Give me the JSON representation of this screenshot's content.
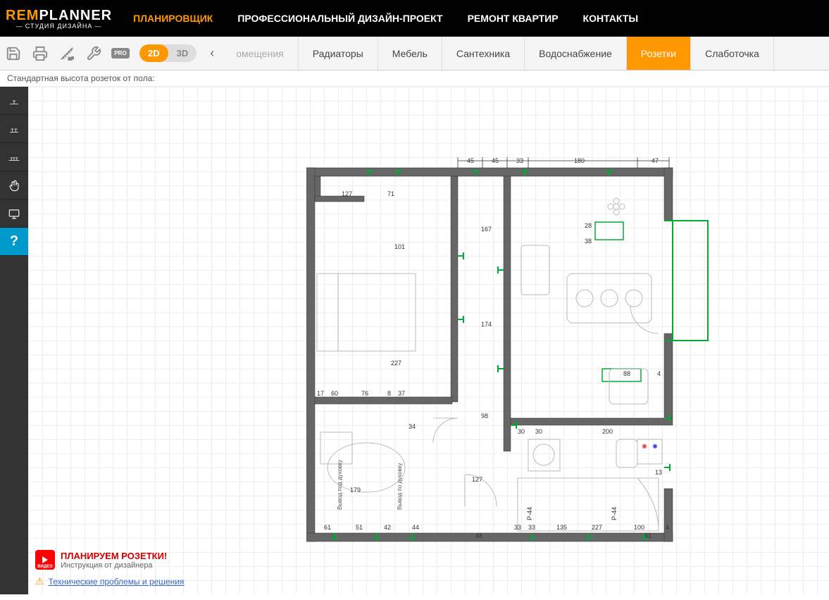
{
  "brand": {
    "rem": "REM",
    "planner": "PLANNER",
    "sub": "СТУДИЯ ДИЗАЙНА"
  },
  "nav": {
    "items": [
      "ПЛАНИРОВЩИК",
      "ПРОФЕССИОНАЛЬНЫЙ ДИЗАЙН-ПРОЕКТ",
      "РЕМОНТ КВАРТИР",
      "КОНТАКТЫ"
    ]
  },
  "view": {
    "d2": "2D",
    "d3": "3D"
  },
  "pro": "PRO",
  "tabs": {
    "partial": "омещения",
    "items": [
      "Радиаторы",
      "Мебель",
      "Сантехника",
      "Водоснабжение",
      "Розетки",
      "Слаботочка"
    ]
  },
  "status": "Стандартная высота розеток от пола:",
  "help": "?",
  "tip": {
    "title": "ПЛАНИРУЕМ РОЗЕТКИ!",
    "sub": "Инструкция от дизайнера",
    "video": "ВИДЕО"
  },
  "tech_link": "Технические проблемы и решения",
  "dims": {
    "top": [
      "45",
      "45",
      "33",
      "180",
      "47"
    ],
    "r1": [
      "127",
      "71"
    ],
    "r2": "167",
    "r3": [
      "28",
      "38"
    ],
    "r4": "101",
    "r5": "174",
    "r6": "227",
    "r7": [
      "88",
      "4"
    ],
    "r8": [
      "17",
      "60",
      "76",
      "8",
      "37"
    ],
    "r9": "98",
    "r10": [
      "30",
      "30",
      "200"
    ],
    "r11": "34",
    "r12": "179",
    "r13": "127",
    "r14": [
      "61",
      "51",
      "42",
      "44"
    ],
    "r15": "48",
    "r16": "13",
    "r17": [
      "33",
      "33",
      "135",
      "227",
      "100",
      "91",
      "4"
    ],
    "r18": [
      "P-44",
      "P-44"
    ],
    "vert": [
      "Вывод под духовку",
      "Вывод по духовку"
    ]
  }
}
